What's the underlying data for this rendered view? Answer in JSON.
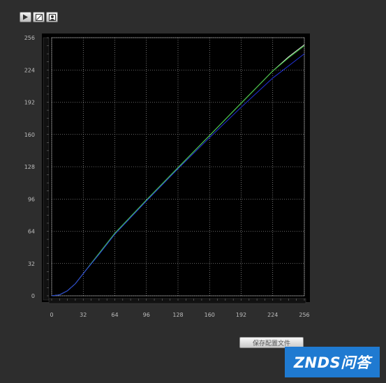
{
  "toolbar": {
    "buttons": [
      {
        "icon": "play-icon"
      },
      {
        "icon": "curve-edit-icon"
      },
      {
        "icon": "image-icon"
      }
    ]
  },
  "save_button": {
    "label": "保存配置文件"
  },
  "watermark": {
    "text": "ZNDS问答"
  },
  "colors": {
    "background": "#2d2d2d",
    "plot_background": "#000000",
    "grid": "#bfbfbf",
    "axis_text": "#bdbdbd",
    "button_face": "#d8d8d8",
    "watermark_bg": "#1f7ad1"
  },
  "chart_data": {
    "type": "line",
    "title": "",
    "xlabel": "",
    "ylabel": "",
    "xlim": [
      0,
      256
    ],
    "ylim": [
      0,
      256
    ],
    "xticks": [
      0,
      32,
      64,
      96,
      128,
      160,
      192,
      224,
      256
    ],
    "yticks": [
      0,
      32,
      64,
      96,
      128,
      160,
      192,
      224,
      256
    ],
    "grid": true,
    "series": [
      {
        "color": "#e0e0e0",
        "x": [
          0,
          8,
          16,
          24,
          32,
          48,
          64,
          96,
          128,
          160,
          192,
          224,
          240,
          256
        ],
        "y": [
          0,
          1,
          5,
          12,
          22,
          42,
          62,
          95,
          127,
          159,
          191,
          223,
          237,
          249
        ]
      },
      {
        "color": "#3ecf3e",
        "x": [
          0,
          8,
          16,
          24,
          32,
          48,
          64,
          96,
          128,
          160,
          192,
          224,
          240,
          256
        ],
        "y": [
          0,
          1,
          5,
          12,
          22,
          42,
          62,
          95,
          127,
          159,
          191,
          223,
          236,
          248
        ]
      },
      {
        "color": "#2233dd",
        "x": [
          0,
          8,
          16,
          24,
          32,
          48,
          64,
          96,
          128,
          160,
          192,
          224,
          240,
          256
        ],
        "y": [
          0,
          1,
          5,
          12,
          22,
          41,
          61,
          94,
          126,
          157,
          187,
          216,
          228,
          240
        ]
      }
    ]
  }
}
